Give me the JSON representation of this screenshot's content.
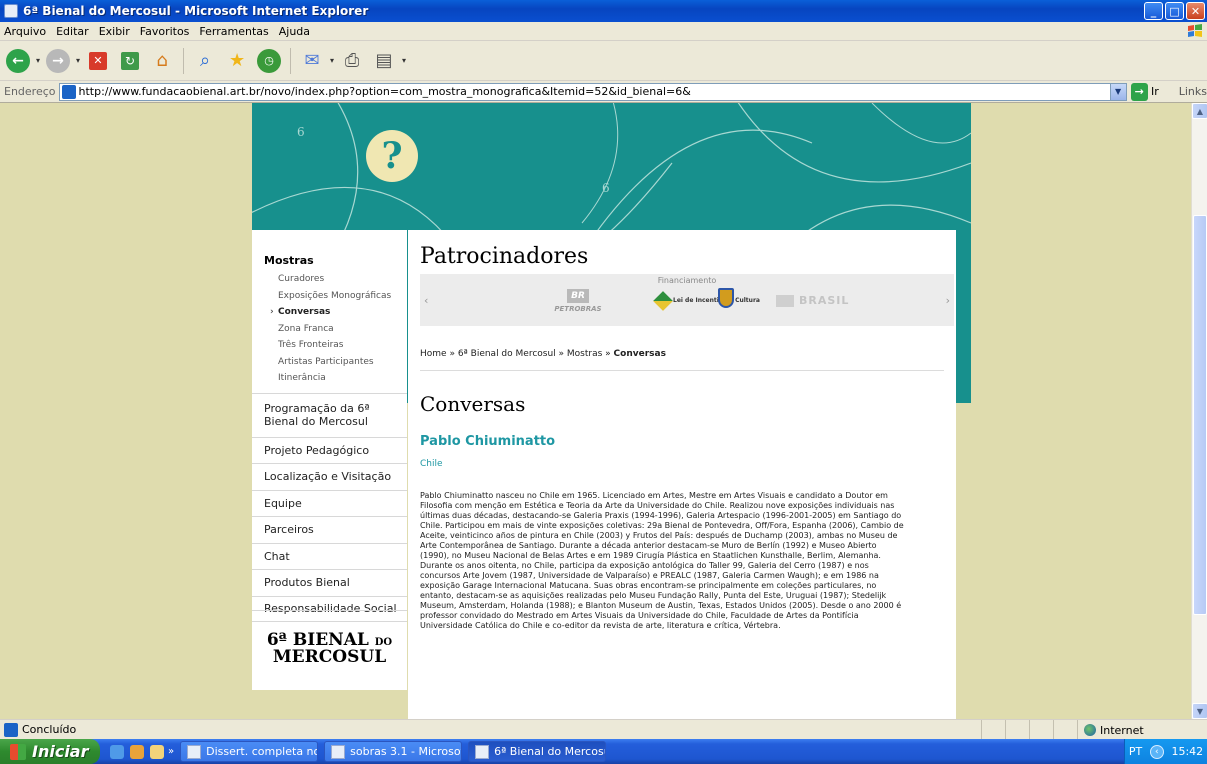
{
  "window": {
    "title": "6ª Bienal do Mercosul - Microsoft Internet Explorer",
    "controls": [
      "_",
      "□",
      "✕"
    ]
  },
  "menu": [
    "Arquivo",
    "Editar",
    "Exibir",
    "Favoritos",
    "Ferramentas",
    "Ajuda"
  ],
  "address": {
    "label": "Endereço",
    "url": "http://www.fundacaobienal.art.br/novo/index.php?option=com_mostra_monografica&Itemid=52&id_bienal=6&",
    "go_label": "Ir",
    "links_label": "Links"
  },
  "banner": {
    "symbol": "?",
    "six_marks": [
      "6",
      "6"
    ]
  },
  "nav": {
    "section_title": "Mostras",
    "subitems": [
      {
        "label": "Curadores"
      },
      {
        "label": "Exposições Monográficas"
      },
      {
        "label": "Conversas",
        "active": true
      },
      {
        "label": "Zona Franca"
      },
      {
        "label": "Três Fronteiras"
      },
      {
        "label": "Artistas Participantes"
      },
      {
        "label": "Itinerância"
      }
    ],
    "items": [
      "Programação da 6ª Bienal do Mercosul",
      "Projeto Pedagógico",
      "Localização e Visitação",
      "Equipe",
      "Parceiros",
      "Chat",
      "Produtos Bienal",
      "Responsabilidade Social"
    ],
    "logo_line1": "6ª BIENAL",
    "logo_do": "DO",
    "logo_line2": "MERCOSUL"
  },
  "content": {
    "sponsors_title": "Patrocinadores",
    "financing_label": "Financiamento",
    "prev": "‹",
    "next": "›",
    "petrobras_mark": "BR",
    "petrobras_name": "PETROBRAS",
    "lei_text": "Lei de Incentivo à Cultura",
    "brasil_text": "BRASIL",
    "breadcrumb": {
      "home": "Home",
      "bienal": "6ª Bienal do Mercosul",
      "mostras": "Mostras",
      "current": "Conversas",
      "sep": " » "
    },
    "page_title": "Conversas",
    "artist_name": "Pablo Chiuminatto",
    "country": "Chile",
    "bio": "Pablo Chiuminatto nasceu no Chile em 1965. Licenciado em Artes, Mestre em Artes Visuais e candidato a Doutor em Filosofia com menção em Estética e Teoria da Arte da Universidade do Chile. Realizou nove exposições individuais nas últimas duas décadas, destacando-se Galeria Praxis (1994-1996), Galeria Artespacio (1996-2001-2005) em Santiago do Chile. Participou em mais de vinte exposições coletivas: 29a Bienal de Pontevedra, Off/Fora, Espanha (2006), Cambio de Aceite, veinticinco años de pintura en Chile (2003) y Frutos del País: después de Duchamp (2003), ambas no Museu de Arte Contemporânea de Santiago. Durante a década anterior destacam-se Muro de Berlín (1992) e Museo Abierto (1990), no Museu Nacional de Belas Artes e em 1989 Cirugía Plástica en Staatlichen Kunsthalle, Berlim, Alemanha. Durante os anos oitenta, no Chile, participa da exposição antológica do Taller 99, Galeria del Cerro (1987) e nos concursos Arte Jovem (1987, Universidade de Valparaíso) e PREALC (1987, Galeria Carmen Waugh); e em 1986 na exposição Garage Internacional Matucana. Suas obras encontram-se principalmente em coleções particulares, no entanto, destacam-se as aquisições realizadas pelo Museu Fundação Rally, Punta del Este, Uruguai (1987); Stedelijk Museum, Amsterdam, Holanda (1988); e Blanton Museum de Austin, Texas, Estados Unidos (2005). Desde o ano 2000 é professor convidado do Mestrado em Artes Visuais da Universidade do Chile, Faculdade de Artes da Pontifícia Universidade Católica do Chile e co-editor da revista de arte, literatura e crítica, Vértebra."
  },
  "status": {
    "text": "Concluído",
    "zone": "Internet"
  },
  "taskbar": {
    "start": "Iniciar",
    "more": "»",
    "tasks": [
      "Dissert. completa no...",
      "sobras 3.1 - Microsof...",
      "6ª Bienal do Mercosul..."
    ],
    "lang": "PT",
    "time": "15:42"
  },
  "colors": {
    "teal": "#17908d",
    "accent": "#1e97a3",
    "page_bg": "#dfdcae",
    "cream": "#f0e7b2"
  }
}
